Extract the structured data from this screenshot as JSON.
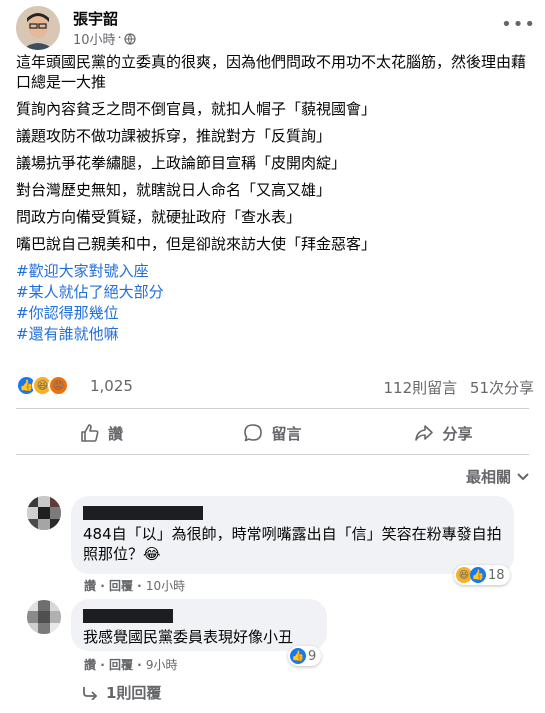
{
  "post": {
    "author": "張宇韶",
    "time": "10小時",
    "paragraphs": [
      "這年頭國民黨的立委真的很爽，因為他們問政不用功不太花腦筋，然後理由藉口總是一大推",
      "質詢內容貧乏之問不倒官員，就扣人帽子「藐視國會」",
      "議題攻防不做功課被拆穿，推說對方「反質詢」",
      "議場抗爭花拳繡腿，上政論節目宣稱「皮開肉綻」",
      "對台灣歷史無知，就瞎說日人命名「又高又雄」",
      "問政方向備受質疑，就硬扯政府「查水表」",
      "嘴巴說自己親美和中，但是卻說來訪大使「拜金惡客」"
    ],
    "hashtags": [
      "#歡迎大家對號入座",
      "#某人就佔了絕大部分",
      "#你認得那幾位",
      "#還有誰就他嘛"
    ],
    "reaction_count": "1,025",
    "comments_count": "112則留言",
    "shares_count": "51次分享"
  },
  "actions": {
    "like": "讚",
    "comment": "留言",
    "share": "分享"
  },
  "sort_label": "最相關",
  "comments": [
    {
      "text": "484自「以」為很帥，時常咧嘴露出自「信」笑容在粉專發自拍照那位？😂",
      "like": "讚",
      "reply": "回覆",
      "time": "10小時",
      "reaction_count": "18"
    },
    {
      "text": "我感覺國民黨委員表現好像小丑",
      "like": "讚",
      "reply": "回覆",
      "time": "9小時",
      "reaction_count": "9"
    }
  ],
  "replies_label": "1則回覆",
  "colors": {
    "link": "#216fdb",
    "secondary": "#65676b",
    "like_blue": "#1877f2",
    "bubble": "#f0f2f5"
  }
}
